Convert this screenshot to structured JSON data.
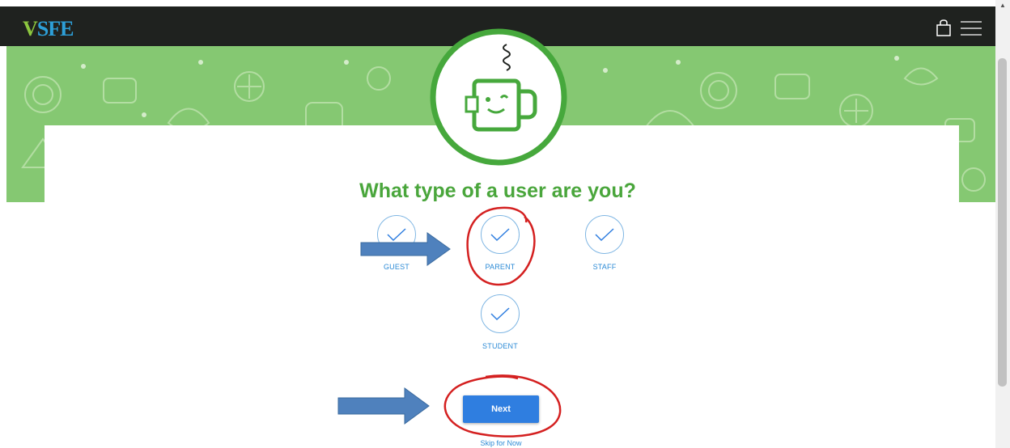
{
  "header": {
    "logo_mark": "V",
    "logo_text": "SFE",
    "icons": [
      "shopping-bag-icon",
      "hamburger-menu-icon"
    ],
    "background_color": "#1f221f"
  },
  "banner": {
    "pattern": "food-doodles",
    "background_color": "#85c872",
    "mascot": "coffee-mug-mascot"
  },
  "main": {
    "title": "What type of a user are you?",
    "user_types": [
      {
        "label": "GUEST",
        "icon": "check-icon"
      },
      {
        "label": "PARENT",
        "icon": "check-icon"
      },
      {
        "label": "STAFF",
        "icon": "check-icon"
      },
      {
        "label": "STUDENT",
        "icon": "check-icon"
      }
    ],
    "next_label": "Next",
    "skip_label": "Skip for Now"
  },
  "colors": {
    "accent_green": "#4aa63c",
    "primary_blue": "#2f7ee0",
    "link_blue": "#2d8bd6",
    "annotation_red": "#d42020",
    "arrow_blue": "#4f81bd"
  }
}
